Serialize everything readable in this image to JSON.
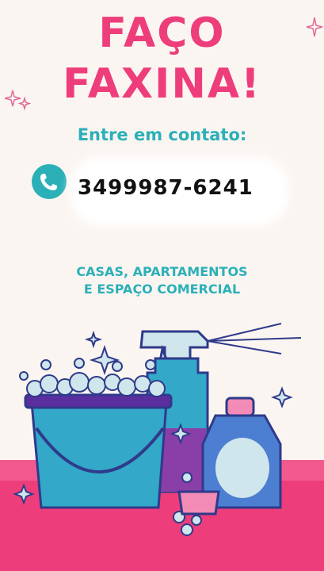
{
  "headline": {
    "line1": "FAÇO",
    "line2": "FAXINA!"
  },
  "contact": {
    "label": "Entre em contato:",
    "phone": "3499987-6241",
    "icon": "phone-icon"
  },
  "services": {
    "line1": "CASAS, APARTAMENTOS",
    "line2": "E ESPAÇO COMERCIAL"
  },
  "colors": {
    "accent": "#ee3d7b",
    "teal": "#2bb0b8",
    "background": "#fbf5f1",
    "floor": "#ee3d7b"
  }
}
